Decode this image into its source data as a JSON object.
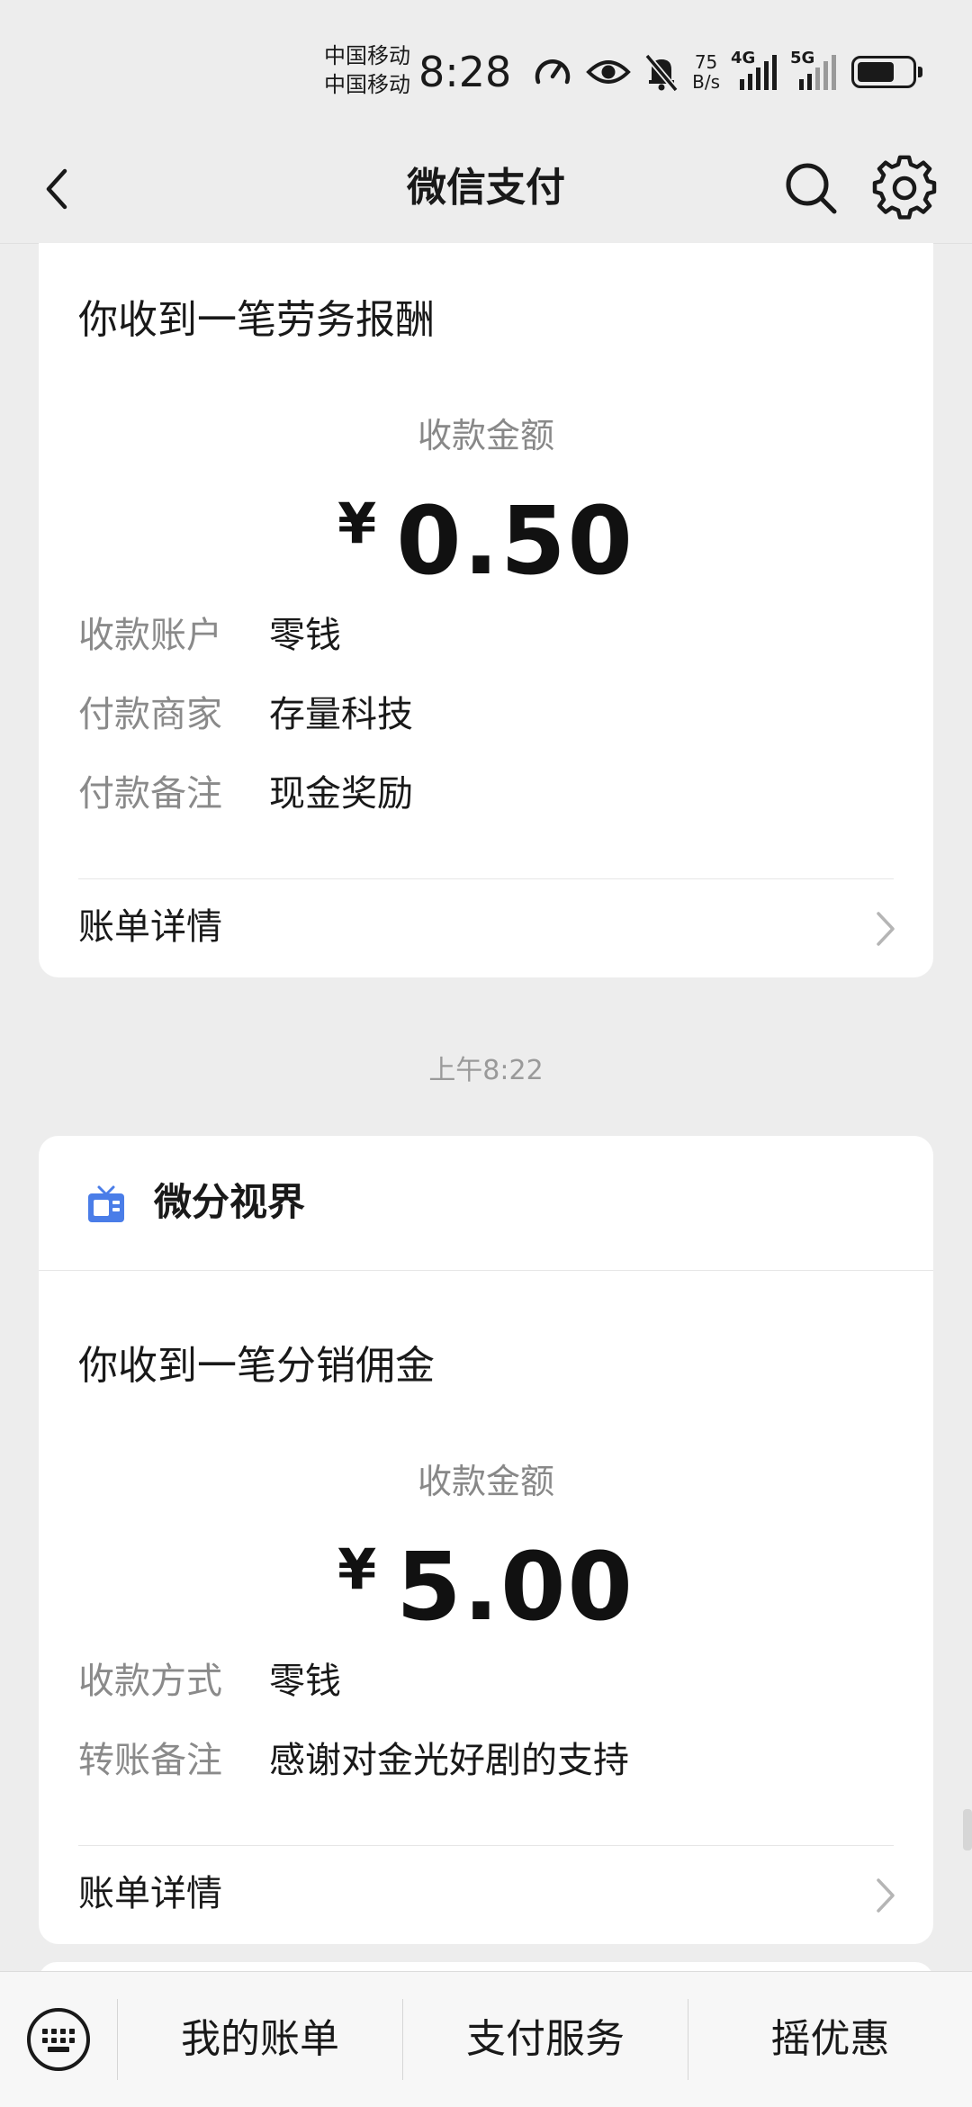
{
  "status_bar": {
    "carrier_1": "中国移动",
    "carrier_2": "中国移动",
    "time": "8:28",
    "net_speed_value": "75",
    "net_speed_unit": "B/s",
    "sim1_label": "4G",
    "sim2_label": "5G",
    "icons": [
      "speedometer-icon",
      "eye-icon",
      "bell-muted-icon",
      "signal-icon",
      "battery-icon"
    ]
  },
  "nav": {
    "title": "微信支付",
    "icons": [
      "back-icon",
      "search-icon",
      "settings-icon"
    ]
  },
  "messages": [
    {
      "title": "你收到一笔劳务报酬",
      "amount_label": "收款金额",
      "currency": "¥",
      "amount": "0.50",
      "rows": [
        {
          "key": "收款账户",
          "value": "零钱"
        },
        {
          "key": "付款商家",
          "value": "存量科技"
        },
        {
          "key": "付款备注",
          "value": "现金奖励"
        }
      ],
      "detail_label": "账单详情"
    },
    {
      "timestamp": "上午8:22",
      "merchant": "微分视界",
      "title": "你收到一笔分销佣金",
      "amount_label": "收款金额",
      "currency": "¥",
      "amount": "5.00",
      "rows": [
        {
          "key": "收款方式",
          "value": "零钱"
        },
        {
          "key": "转账备注",
          "value": "感谢对金光好剧的支持"
        }
      ],
      "detail_label": "账单详情"
    }
  ],
  "bottom_menu": {
    "items": [
      "我的账单",
      "支付服务",
      "摇优惠"
    ],
    "keyboard_icon": "keyboard-icon"
  },
  "colors": {
    "background": "#ededed",
    "card": "#ffffff",
    "text_primary": "#191919",
    "text_secondary": "#888888",
    "merchant_icon": "#4a7de8"
  }
}
